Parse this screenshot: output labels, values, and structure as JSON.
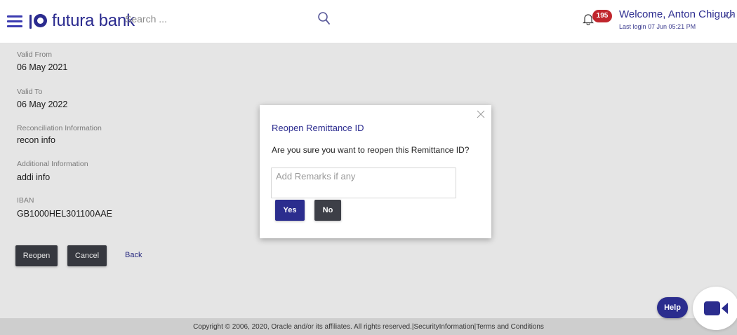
{
  "header": {
    "brand": "futura bank",
    "search_placeholder": "Search ...",
    "notification_count": "195",
    "welcome": "Welcome, Anton Chigurh",
    "last_login": "Last login 07 Jun 05:21 PM"
  },
  "details": [
    {
      "label": "Valid From",
      "value": "06 May 2021"
    },
    {
      "label": "Valid To",
      "value": "06 May 2022"
    },
    {
      "label": "Reconciliation Information",
      "value": "recon info"
    },
    {
      "label": "Additional Information",
      "value": "addi info"
    },
    {
      "label": "IBAN",
      "value": "GB1000HEL301100AAE"
    }
  ],
  "actions": {
    "reopen": "Reopen",
    "cancel": "Cancel",
    "back": "Back"
  },
  "modal": {
    "title": "Reopen Remittance ID",
    "message": "Are you sure you want to reopen this Remittance ID?",
    "remarks_placeholder": "Add Remarks if any",
    "remarks_value": "",
    "yes": "Yes",
    "no": "No"
  },
  "help": "Help",
  "footer": "Copyright © 2006, 2020, Oracle and/or its affiliates. All rights reserved.|SecurityInformation|Terms and Conditions",
  "colors": {
    "brand": "#2b2b8f",
    "badge": "#c0262d",
    "primary_button": "#2b2d8e",
    "secondary_button": "#3d3f47"
  },
  "icons": [
    "hamburger-menu-icon",
    "futura-logo-icon",
    "search-icon",
    "bell-icon",
    "chevron-down-icon",
    "close-icon",
    "video-camera-icon"
  ]
}
